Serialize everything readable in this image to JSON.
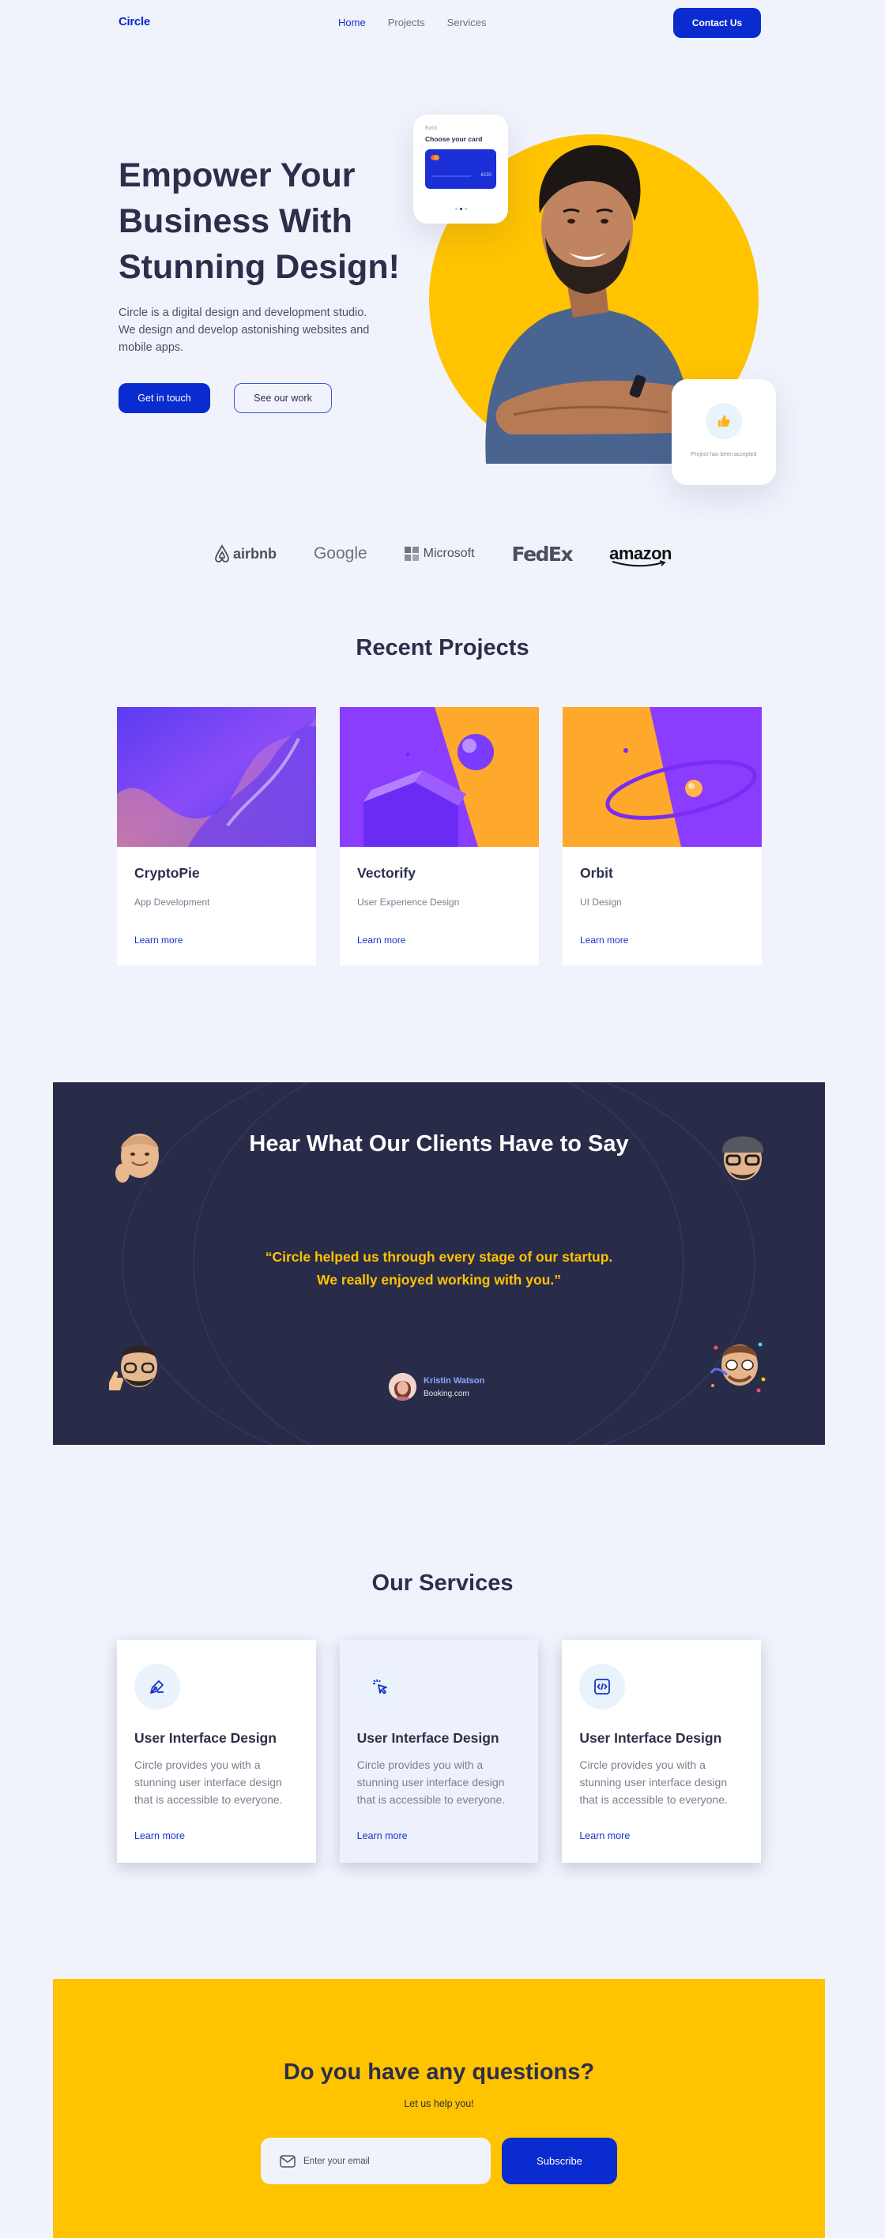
{
  "nav": {
    "logo": "Circle",
    "links": [
      "Home",
      "Projects",
      "Services"
    ],
    "contact_label": "Contact Us"
  },
  "hero": {
    "title": "Empower Your Business With Stunning Design!",
    "description": "Circle is a digital design and development studio. We design and develop astonishing websites and mobile apps.",
    "primary_button": "Get in touch",
    "secondary_button": "See our work",
    "card_widget": {
      "label": "Back",
      "title": "Choose your card",
      "card_amount": "€150"
    },
    "accept_widget": {
      "icon": "thumbs-up-icon",
      "text": "Project has been accepted"
    }
  },
  "brands": [
    "airbnb",
    "Google",
    "Microsoft",
    "FedEx",
    "amazon"
  ],
  "projects": {
    "title": "Recent Projects",
    "items": [
      {
        "name": "CryptoPie",
        "category": "App Development",
        "link": "Learn more"
      },
      {
        "name": "Vectorify",
        "category": "User Experience Design",
        "link": "Learn more"
      },
      {
        "name": "Orbit",
        "category": "UI Design",
        "link": "Learn more"
      }
    ]
  },
  "testimonials": {
    "title": "Hear What Our Clients Have to Say",
    "quote_line1": "“Circle helped us through every stage of our startup.",
    "quote_line2": "We really enjoyed working with you.”",
    "author_name": "Kristin Watson",
    "author_company": "Booking.com"
  },
  "services": {
    "title": "Our Services",
    "items": [
      {
        "icon": "pen-tool-icon",
        "title": "User Interface Design",
        "description": "Circle provides you with a stunning user interface design that is accessible to everyone.",
        "link": "Learn more"
      },
      {
        "icon": "cursor-click-icon",
        "title": "User Interface Design",
        "description": "Circle provides you with a stunning user interface design that is accessible to everyone.",
        "link": "Learn more"
      },
      {
        "icon": "code-icon",
        "title": "User Interface Design",
        "description": "Circle provides you with a stunning user interface design that is accessible to everyone.",
        "link": "Learn more"
      }
    ]
  },
  "cta": {
    "title": "Do you have any questions?",
    "subtitle": "Let us help you!",
    "email_placeholder": "Enter your email",
    "subscribe_label": "Subscribe"
  },
  "colors": {
    "primary": "#0a2bcf",
    "accent_yellow": "#ffc300",
    "dark_navy": "#292c48",
    "background": "#f0f3fc"
  }
}
